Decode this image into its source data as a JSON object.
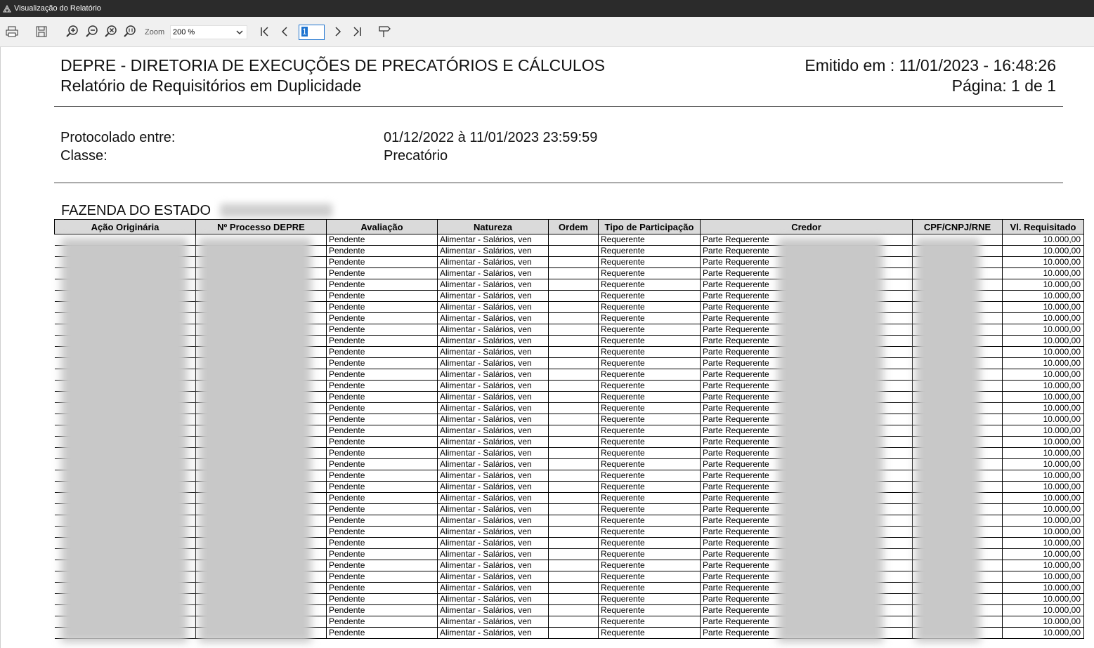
{
  "window": {
    "title": "Visualização do Relatório"
  },
  "toolbar": {
    "zoom_label": "Zoom",
    "zoom_value": "200 %",
    "page_value": "1"
  },
  "report": {
    "org": "DEPRE - DIRETORIA DE EXECUÇÕES DE PRECATÓRIOS E CÁLCULOS",
    "subtitle": "Relatório de Requisitórios em Duplicidade",
    "emitted": "Emitido em : 11/01/2023 - 16:48:26",
    "page": "Página: 1 de 1",
    "protocol_label": "Protocolado entre:",
    "protocol_value": "01/12/2022 à 11/01/2023 23:59:59",
    "class_label": "Classe:",
    "class_value": "Precatório",
    "section": "FAZENDA DO ESTADO"
  },
  "table": {
    "columns": [
      "Ação Originária",
      "Nº Processo DEPRE",
      "Avaliação",
      "Natureza",
      "Ordem",
      "Tipo de Participação",
      "Credor",
      "CPF/CNPJ/RNE",
      "Vl. Requisitado"
    ],
    "rows": [
      {
        "avaliacao": "Pendente",
        "natureza": "Alimentar - Salários, ven",
        "ordem": "",
        "tipo": "Requerente",
        "credor": "Parte Requerente",
        "valor": "10.000,00"
      },
      {
        "avaliacao": "Pendente",
        "natureza": "Alimentar - Salários, ven",
        "ordem": "",
        "tipo": "Requerente",
        "credor": "Parte Requerente",
        "valor": "10.000,00"
      },
      {
        "avaliacao": "Pendente",
        "natureza": "Alimentar - Salários, ven",
        "ordem": "",
        "tipo": "Requerente",
        "credor": "Parte Requerente",
        "valor": "10.000,00"
      },
      {
        "avaliacao": "Pendente",
        "natureza": "Alimentar - Salários, ven",
        "ordem": "",
        "tipo": "Requerente",
        "credor": "Parte Requerente",
        "valor": "10.000,00"
      },
      {
        "avaliacao": "Pendente",
        "natureza": "Alimentar - Salários, ven",
        "ordem": "",
        "tipo": "Requerente",
        "credor": "Parte Requerente",
        "valor": "10.000,00"
      },
      {
        "avaliacao": "Pendente",
        "natureza": "Alimentar - Salários, ven",
        "ordem": "",
        "tipo": "Requerente",
        "credor": "Parte Requerente",
        "valor": "10.000,00"
      },
      {
        "avaliacao": "Pendente",
        "natureza": "Alimentar - Salários, ven",
        "ordem": "",
        "tipo": "Requerente",
        "credor": "Parte Requerente",
        "valor": "10.000,00"
      },
      {
        "avaliacao": "Pendente",
        "natureza": "Alimentar - Salários, ven",
        "ordem": "",
        "tipo": "Requerente",
        "credor": "Parte Requerente",
        "valor": "10.000,00"
      },
      {
        "avaliacao": "Pendente",
        "natureza": "Alimentar - Salários, ven",
        "ordem": "",
        "tipo": "Requerente",
        "credor": "Parte Requerente",
        "valor": "10.000,00"
      },
      {
        "avaliacao": "Pendente",
        "natureza": "Alimentar - Salários, ven",
        "ordem": "",
        "tipo": "Requerente",
        "credor": "Parte Requerente",
        "valor": "10.000,00"
      },
      {
        "avaliacao": "Pendente",
        "natureza": "Alimentar - Salários, ven",
        "ordem": "",
        "tipo": "Requerente",
        "credor": "Parte Requerente",
        "valor": "10.000,00"
      },
      {
        "avaliacao": "Pendente",
        "natureza": "Alimentar - Salários, ven",
        "ordem": "",
        "tipo": "Requerente",
        "credor": "Parte Requerente",
        "valor": "10.000,00"
      },
      {
        "avaliacao": "Pendente",
        "natureza": "Alimentar - Salários, ven",
        "ordem": "",
        "tipo": "Requerente",
        "credor": "Parte Requerente",
        "valor": "10.000,00"
      },
      {
        "avaliacao": "Pendente",
        "natureza": "Alimentar - Salários, ven",
        "ordem": "",
        "tipo": "Requerente",
        "credor": "Parte Requerente",
        "valor": "10.000,00"
      },
      {
        "avaliacao": "Pendente",
        "natureza": "Alimentar - Salários, ven",
        "ordem": "",
        "tipo": "Requerente",
        "credor": "Parte Requerente",
        "valor": "10.000,00"
      },
      {
        "avaliacao": "Pendente",
        "natureza": "Alimentar - Salários, ven",
        "ordem": "",
        "tipo": "Requerente",
        "credor": "Parte Requerente",
        "valor": "10.000,00"
      },
      {
        "avaliacao": "Pendente",
        "natureza": "Alimentar - Salários, ven",
        "ordem": "",
        "tipo": "Requerente",
        "credor": "Parte Requerente",
        "valor": "10.000,00"
      },
      {
        "avaliacao": "Pendente",
        "natureza": "Alimentar - Salários, ven",
        "ordem": "",
        "tipo": "Requerente",
        "credor": "Parte Requerente",
        "valor": "10.000,00"
      },
      {
        "avaliacao": "Pendente",
        "natureza": "Alimentar - Salários, ven",
        "ordem": "",
        "tipo": "Requerente",
        "credor": "Parte Requerente",
        "valor": "10.000,00"
      },
      {
        "avaliacao": "Pendente",
        "natureza": "Alimentar - Salários, ven",
        "ordem": "",
        "tipo": "Requerente",
        "credor": "Parte Requerente",
        "valor": "10.000,00"
      },
      {
        "avaliacao": "Pendente",
        "natureza": "Alimentar - Salários, ven",
        "ordem": "",
        "tipo": "Requerente",
        "credor": "Parte Requerente",
        "valor": "10.000,00"
      },
      {
        "avaliacao": "Pendente",
        "natureza": "Alimentar - Salários, ven",
        "ordem": "",
        "tipo": "Requerente",
        "credor": "Parte Requerente",
        "valor": "10.000,00"
      },
      {
        "avaliacao": "Pendente",
        "natureza": "Alimentar - Salários, ven",
        "ordem": "",
        "tipo": "Requerente",
        "credor": "Parte Requerente",
        "valor": "10.000,00"
      },
      {
        "avaliacao": "Pendente",
        "natureza": "Alimentar - Salários, ven",
        "ordem": "",
        "tipo": "Requerente",
        "credor": "Parte Requerente",
        "valor": "10.000,00"
      },
      {
        "avaliacao": "Pendente",
        "natureza": "Alimentar - Salários, ven",
        "ordem": "",
        "tipo": "Requerente",
        "credor": "Parte Requerente",
        "valor": "10.000,00"
      },
      {
        "avaliacao": "Pendente",
        "natureza": "Alimentar - Salários, ven",
        "ordem": "",
        "tipo": "Requerente",
        "credor": "Parte Requerente",
        "valor": "10.000,00"
      },
      {
        "avaliacao": "Pendente",
        "natureza": "Alimentar - Salários, ven",
        "ordem": "",
        "tipo": "Requerente",
        "credor": "Parte Requerente",
        "valor": "10.000,00"
      },
      {
        "avaliacao": "Pendente",
        "natureza": "Alimentar - Salários, ven",
        "ordem": "",
        "tipo": "Requerente",
        "credor": "Parte Requerente",
        "valor": "10.000,00"
      },
      {
        "avaliacao": "Pendente",
        "natureza": "Alimentar - Salários, ven",
        "ordem": "",
        "tipo": "Requerente",
        "credor": "Parte Requerente",
        "valor": "10.000,00"
      },
      {
        "avaliacao": "Pendente",
        "natureza": "Alimentar - Salários, ven",
        "ordem": "",
        "tipo": "Requerente",
        "credor": "Parte Requerente",
        "valor": "10.000,00"
      },
      {
        "avaliacao": "Pendente",
        "natureza": "Alimentar - Salários, ven",
        "ordem": "",
        "tipo": "Requerente",
        "credor": "Parte Requerente",
        "valor": "10.000,00"
      },
      {
        "avaliacao": "Pendente",
        "natureza": "Alimentar - Salários, ven",
        "ordem": "",
        "tipo": "Requerente",
        "credor": "Parte Requerente",
        "valor": "10.000,00"
      },
      {
        "avaliacao": "Pendente",
        "natureza": "Alimentar - Salários, ven",
        "ordem": "",
        "tipo": "Requerente",
        "credor": "Parte Requerente",
        "valor": "10.000,00"
      },
      {
        "avaliacao": "Pendente",
        "natureza": "Alimentar - Salários, ven",
        "ordem": "",
        "tipo": "Requerente",
        "credor": "Parte Requerente",
        "valor": "10.000,00"
      },
      {
        "avaliacao": "Pendente",
        "natureza": "Alimentar - Salários, ven",
        "ordem": "",
        "tipo": "Requerente",
        "credor": "Parte Requerente",
        "valor": "10.000,00"
      },
      {
        "avaliacao": "Pendente",
        "natureza": "Alimentar - Salários, ven",
        "ordem": "",
        "tipo": "Requerente",
        "credor": "Parte Requerente",
        "valor": "10.000,00"
      }
    ]
  }
}
